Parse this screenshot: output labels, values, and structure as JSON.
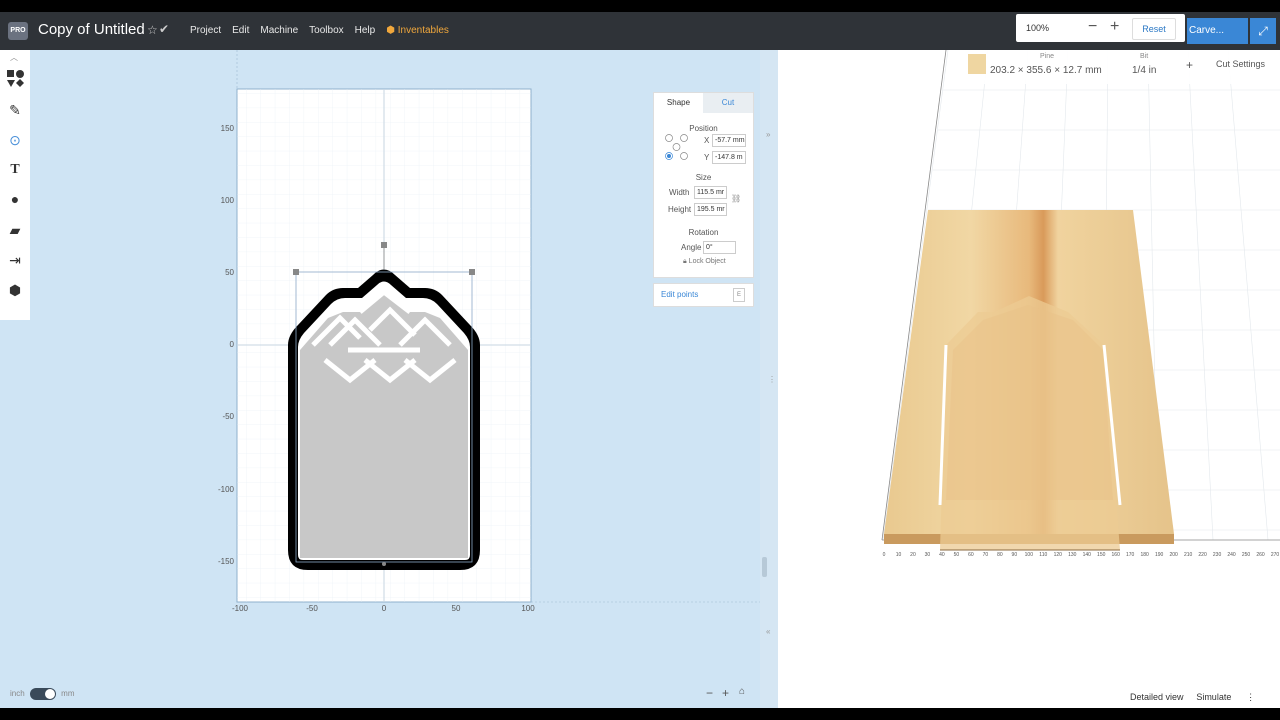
{
  "header": {
    "logo_text": "PRO",
    "project_title": "Copy of Untitled",
    "menu": [
      "Project",
      "Edit",
      "Machine",
      "Toolbox",
      "Help"
    ],
    "inventables_label": "Inventables",
    "zoom_value": "100%",
    "reset_label": "Reset",
    "carve_label": "Carve..."
  },
  "design_canvas": {
    "y_ticks": [
      "150",
      "100",
      "50",
      "0",
      "-50",
      "-100",
      "-150"
    ],
    "x_ticks": [
      "-100",
      "-50",
      "0",
      "50",
      "100"
    ]
  },
  "shape_panel": {
    "tabs": [
      "Shape",
      "Cut"
    ],
    "position_label": "Position",
    "x_label": "X",
    "x_value": "-57.7 mm",
    "y_label": "Y",
    "y_value": "-147.8 m",
    "size_label": "Size",
    "width_label": "Width",
    "width_value": "115.5 mr",
    "height_label": "Height",
    "height_value": "195.5 mr",
    "rotation_label": "Rotation",
    "angle_label": "Angle",
    "angle_value": "0°",
    "lock_label": "Lock Object",
    "edit_points_label": "Edit points"
  },
  "material_bar": {
    "material_name": "Pine",
    "material_dims": "203.2 × 355.6 × 12.7 mm",
    "bit_label": "Bit",
    "bit_value": "1/4 in",
    "plus_label": "+",
    "cut_settings_label": "Cut Settings"
  },
  "preview": {
    "x_ticks": [
      "0",
      "10",
      "20",
      "30",
      "40",
      "50",
      "60",
      "70",
      "80",
      "90",
      "100",
      "110",
      "120",
      "130",
      "140",
      "150",
      "160",
      "170",
      "180",
      "190",
      "200",
      "210",
      "220",
      "230",
      "240",
      "250",
      "260",
      "270"
    ]
  },
  "footer": {
    "unit_inch": "inch",
    "unit_mm": "mm",
    "detailed_view": "Detailed view",
    "simulate": "Simulate"
  },
  "colors": {
    "accent": "#3a87d6",
    "topbar": "#2f3338",
    "canvas_bg": "#cfe4f4",
    "inventables": "#f0a73c"
  }
}
